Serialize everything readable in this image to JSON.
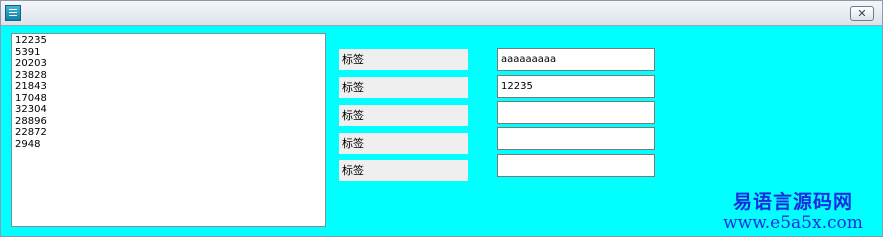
{
  "window": {
    "background": "#00ffff",
    "close_label": "✕"
  },
  "listbox": {
    "items": [
      "12235",
      "5391",
      "20203",
      "23828",
      "21843",
      "17048",
      "32304",
      "28896",
      "22872",
      "2948"
    ]
  },
  "labels": [
    "标签",
    "标签",
    "标签",
    "标签",
    "标签"
  ],
  "fields": [
    {
      "value": "aaaaaaaaa"
    },
    {
      "value": "12235"
    },
    {
      "value": ""
    },
    {
      "value": ""
    },
    {
      "value": ""
    }
  ],
  "watermark": {
    "title": "易语言源码网",
    "url": "www.e5a5x.com",
    "color": "#1a2ce0"
  }
}
